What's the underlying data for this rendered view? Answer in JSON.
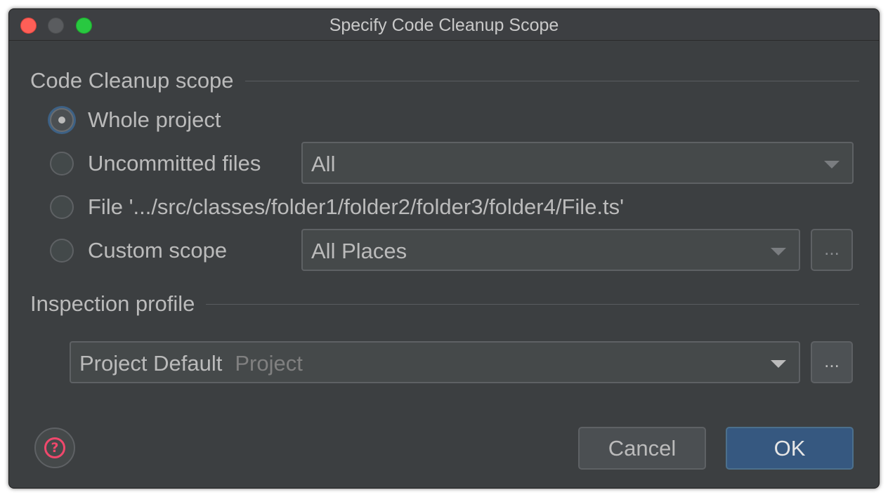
{
  "window": {
    "title": "Specify Code Cleanup Scope"
  },
  "scope_section": {
    "title": "Code Cleanup scope",
    "options": [
      {
        "label": "Whole project",
        "checked": true
      },
      {
        "label": "Uncommitted files",
        "checked": false
      },
      {
        "label": "File '.../src/classes/folder1/folder2/folder3/folder4/File.ts'",
        "checked": false
      },
      {
        "label": "Custom scope",
        "checked": false
      }
    ],
    "uncommitted_select": {
      "value": "All"
    },
    "custom_scope_select": {
      "value": "All Places"
    },
    "custom_scope_browse_label": "..."
  },
  "profile_section": {
    "title": "Inspection profile",
    "profile_select": {
      "value": "Project Default",
      "secondary": "Project"
    },
    "profile_browse_label": "..."
  },
  "buttons": {
    "help_label": "?",
    "cancel_label": "Cancel",
    "ok_label": "OK"
  },
  "colors": {
    "window_bg": "#3c3f41",
    "accent_blue": "#365880",
    "help_icon": "#f0486c",
    "close_red": "#fe5f57",
    "maximize_green": "#28c840"
  },
  "icons": {
    "close": "close-traffic-light",
    "minimize": "minimize-traffic-light",
    "maximize": "maximize-traffic-light",
    "help": "question-circle-icon",
    "dropdown": "chevron-down-icon"
  }
}
